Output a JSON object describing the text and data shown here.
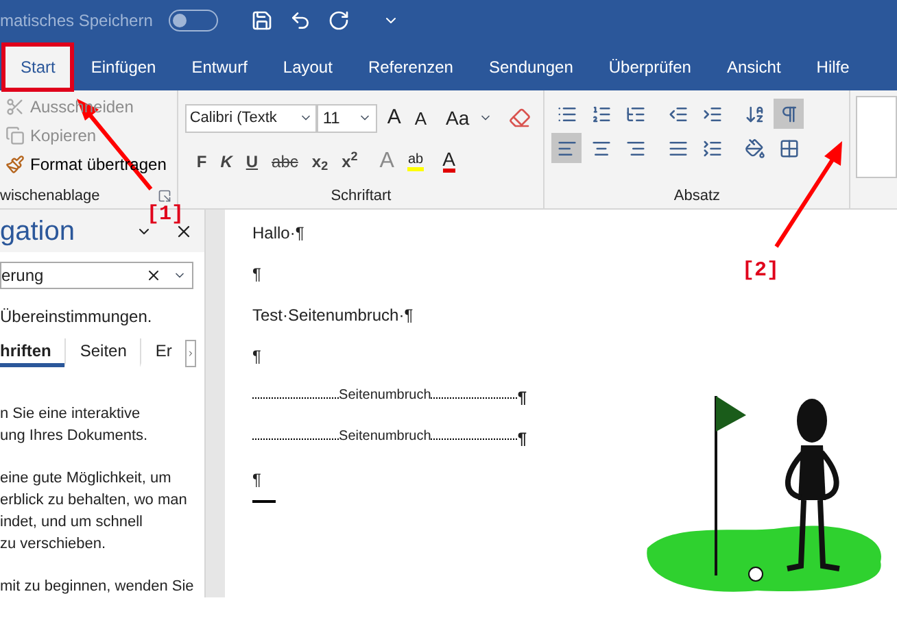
{
  "title_bar": {
    "autosave_label": "matisches Speichern",
    "autosave_on": false
  },
  "tabs": [
    {
      "label": "Start",
      "selected": true,
      "highlighted": true
    },
    {
      "label": "Einfügen",
      "selected": false,
      "highlighted": false
    },
    {
      "label": "Entwurf",
      "selected": false,
      "highlighted": false
    },
    {
      "label": "Layout",
      "selected": false,
      "highlighted": false
    },
    {
      "label": "Referenzen",
      "selected": false,
      "highlighted": false
    },
    {
      "label": "Sendungen",
      "selected": false,
      "highlighted": false
    },
    {
      "label": "Überprüfen",
      "selected": false,
      "highlighted": false
    },
    {
      "label": "Ansicht",
      "selected": false,
      "highlighted": false
    },
    {
      "label": "Hilfe",
      "selected": false,
      "highlighted": false
    }
  ],
  "clipboard": {
    "label": "wischenablage",
    "items": [
      {
        "label": "Ausschneiden",
        "disabled": true
      },
      {
        "label": "Kopieren",
        "disabled": true
      },
      {
        "label": "Format übertragen",
        "disabled": false
      }
    ]
  },
  "font": {
    "label": "Schriftart",
    "font_name": "Calibri (Textk",
    "font_size": "11",
    "grow": "A",
    "shrink": "A",
    "case": "Aa",
    "format_buttons": [
      "F",
      "K",
      "U",
      "abc",
      "x$_{2}$",
      "x$^{2}$"
    ],
    "effects": "A",
    "highlight": "ab",
    "font_color_label": "A"
  },
  "paragraph": {
    "label": "Absatz",
    "row1": [
      {
        "selected": false
      },
      {
        "selected": false
      },
      {
        "selected": false
      },
      {
        "selected": false
      },
      {
        "selected": false
      },
      {
        "selected": false
      },
      {
        "selected": true
      }
    ],
    "row2": [
      {
        "selected": true
      },
      {
        "selected": false
      },
      {
        "selected": false
      },
      {
        "selected": false
      },
      {
        "selected": false
      },
      {
        "selected": false
      },
      {
        "selected": false
      }
    ]
  },
  "navigation": {
    "title": "gation",
    "search_value": "erung",
    "matches": "Übereinstimmungen.",
    "tabs": [
      {
        "label": "hriften",
        "selected": true
      },
      {
        "label": "Seiten",
        "selected": false
      },
      {
        "label": "Er",
        "selected": false
      }
    ],
    "paragraphs": [
      {
        "lines": [
          "n Sie eine interaktive",
          "ung Ihres Dokuments."
        ]
      },
      {
        "lines": [
          "eine gute Möglichkeit, um",
          "erblick zu behalten, wo man",
          "indet, und um schnell",
          "zu verschieben."
        ]
      },
      {
        "lines": [
          "mit zu beginnen, wenden Sie"
        ]
      }
    ]
  },
  "document": [
    {
      "kind": "text",
      "text": "Hallo·¶"
    },
    {
      "kind": "text",
      "text": "¶"
    },
    {
      "kind": "text",
      "text": "Test·Seitenumbruch·¶"
    },
    {
      "kind": "text",
      "text": "¶"
    },
    {
      "kind": "break",
      "text": "Seitenumbruch",
      "mark": "¶"
    },
    {
      "kind": "break",
      "text": "Seitenumbruch",
      "mark": "¶"
    },
    {
      "kind": "text",
      "text": "¶"
    },
    {
      "kind": "end"
    }
  ],
  "annotations": [
    "[1]",
    "[2]"
  ]
}
